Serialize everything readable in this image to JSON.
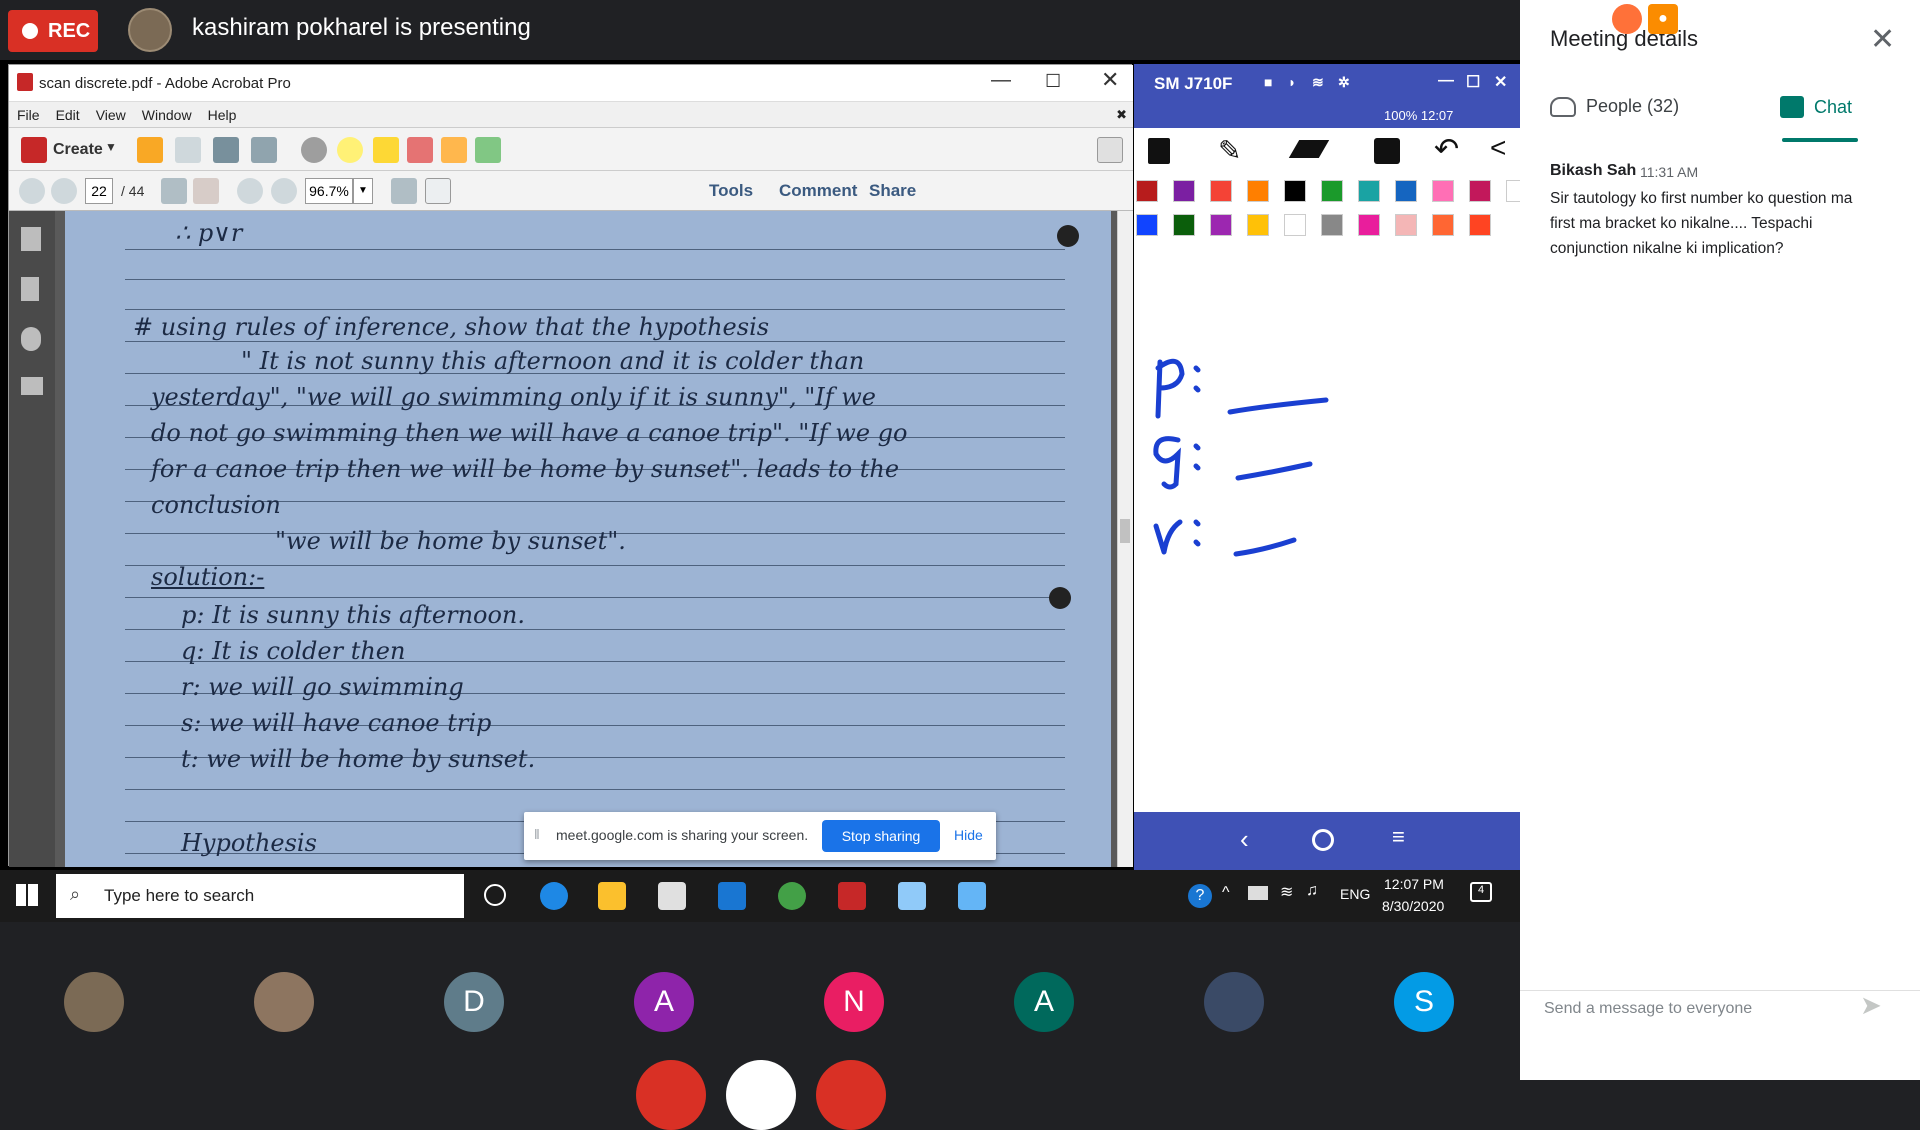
{
  "topbar": {
    "rec_label": "REC",
    "presenting_text": "kashiram pokharel is presenting"
  },
  "acrobat": {
    "window_title": "scan discrete.pdf - Adobe Acrobat Pro",
    "menu": [
      "File",
      "Edit",
      "View",
      "Window",
      "Help"
    ],
    "create_label": "Create",
    "page_current": "22",
    "page_total": "/ 44",
    "zoom": "96.7%",
    "tools_label": "Tools",
    "comment_label": "Comment",
    "share_label": "Share"
  },
  "document": {
    "lines": [
      "∴ p∨r",
      "# using rules of inference, show that the hypothesis",
      "\" It is not sunny this afternoon and it is colder than",
      "yesterday\", \"we will go swimming only if it is sunny\", \"If we",
      "do not go swimming then we will have a canoe trip\". \"If we go",
      "for a canoe trip then we will be home by sunset\". leads to the",
      "conclusion",
      "\"we will be home by sunset\".",
      "solution:-",
      "p: It is sunny this afternoon.",
      "q: It is colder then",
      "r: we will go swimming",
      "s: we will have canoe trip",
      "t: we will be home by sunset.",
      "Hypothesis"
    ]
  },
  "phone": {
    "device_name": "SM J710F",
    "status": "100% 12:07",
    "colors": [
      "#b71c1c",
      "#7b1fa2",
      "#f44336",
      "#ff7f00",
      "#000000",
      "#1b9a2b",
      "#1aa3a3",
      "#1565c0",
      "#ff6fb5",
      "#c2185b",
      "#ffffff",
      "#1144ff",
      "#0b5e0b",
      "#9c27b0",
      "#ffc107",
      "#ffffff",
      "#888888",
      "#e91e9c",
      "#f4b6b6",
      "#ff6633",
      "#ff4422"
    ],
    "handwriting": [
      "p: ——",
      "q: ——",
      "r: ——"
    ]
  },
  "share_notice": {
    "message": "meet.google.com is sharing your screen.",
    "stop_label": "Stop sharing",
    "hide_label": "Hide"
  },
  "taskbar": {
    "search_placeholder": "Type here to search",
    "lang": "ENG",
    "time": "12:07 PM",
    "date": "8/30/2020",
    "notif_count": "4"
  },
  "participants": [
    {
      "initial": "",
      "color": "#7b6a55"
    },
    {
      "initial": "",
      "color": "#8d7560"
    },
    {
      "initial": "D",
      "color": "#5f7c8a"
    },
    {
      "initial": "A",
      "color": "#8e24aa"
    },
    {
      "initial": "N",
      "color": "#e91e63"
    },
    {
      "initial": "A",
      "color": "#00695c"
    },
    {
      "initial": "",
      "color": "#3a4a66"
    },
    {
      "initial": "S",
      "color": "#039be5"
    }
  ],
  "panel": {
    "title": "Meeting details",
    "people_tab": "People (32)",
    "chat_tab": "Chat",
    "message": {
      "sender": "Bikash Sah",
      "time": "11:31 AM",
      "text": "Sir tautology ko first number ko question ma first ma bracket ko nikalne.... Tespachi conjunction nikalne ki implication?"
    },
    "input_placeholder": "Send a message to everyone"
  }
}
